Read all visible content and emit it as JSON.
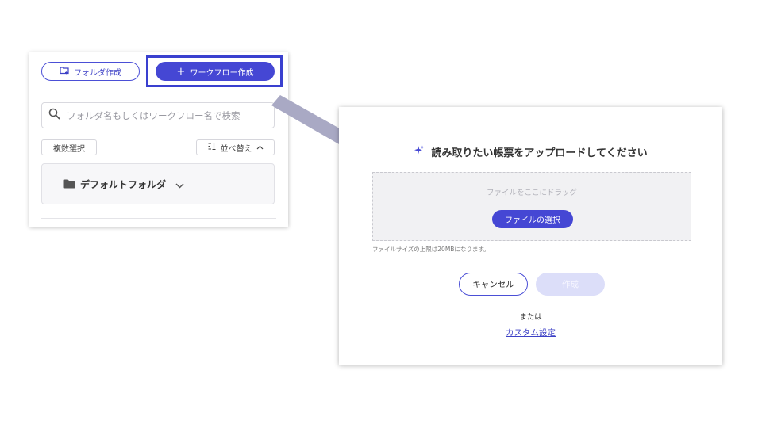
{
  "left_panel": {
    "create_folder_label": "フォルダ作成",
    "create_workflow_label": "ワークフロー作成",
    "search": {
      "placeholder": "フォルダ名もしくはワークフロー名で検索",
      "value": ""
    },
    "multi_select_label": "複数選択",
    "sort_label": "並べ替え",
    "folder": {
      "label": "デフォルトフォルダ"
    }
  },
  "upload_dialog": {
    "title": "読み取りたい帳票をアップロードしてください",
    "drop_hint": "ファイルをここにドラッグ",
    "select_file_label": "ファイルの選択",
    "size_note": "ファイルサイズの上限は20MBになります。",
    "cancel_label": "キャンセル",
    "create_label": "作成",
    "or_label": "または",
    "custom_settings_label": "カスタム設定"
  },
  "icons": {
    "create_folder": "folder-plus-icon",
    "create_workflow": "plus-icon",
    "search": "search-icon",
    "sort": "sort-icon",
    "sort_direction": "chevron-up-icon",
    "folder": "folder-icon",
    "folder_expand": "chevron-down-icon",
    "title": "sparkle-icon"
  },
  "colors": {
    "accent": "#4547d4",
    "highlight_border": "#3a40cf",
    "arrow": "#a9a9c4",
    "disabled_button": "#dcdef9",
    "dropzone_bg": "#f1f1f3"
  }
}
